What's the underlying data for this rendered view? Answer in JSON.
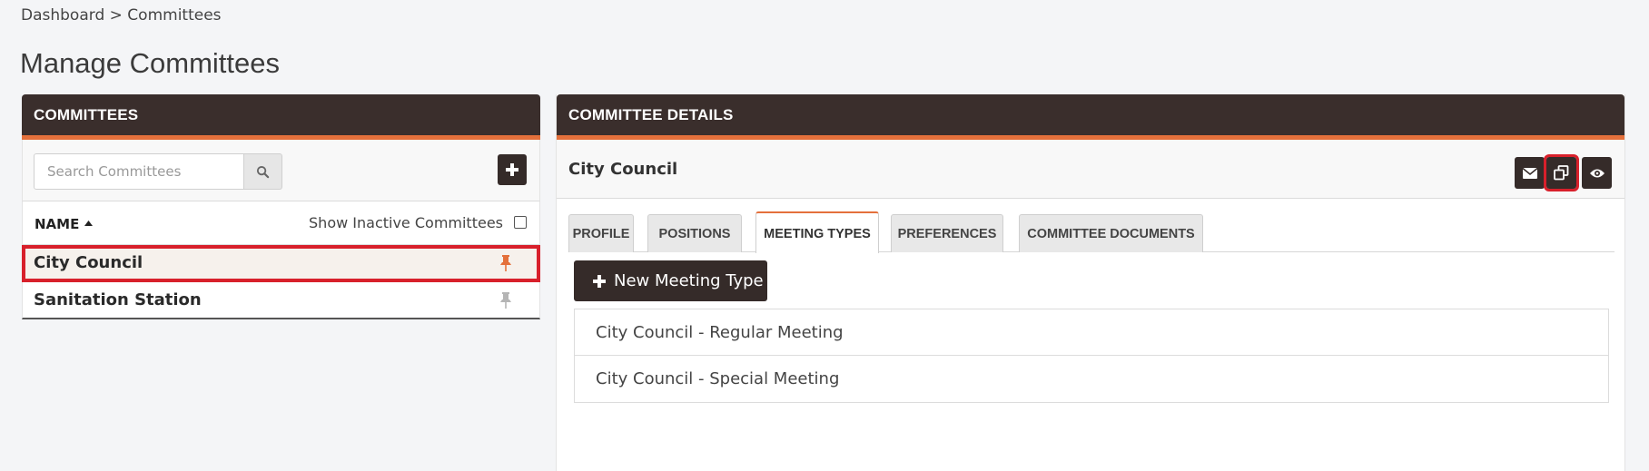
{
  "breadcrumb": {
    "root": "Dashboard",
    "separator": ">",
    "current": "Committees"
  },
  "page_title": "Manage Committees",
  "committees_panel": {
    "title": "COMMITTEES",
    "search_placeholder": "Search Committees",
    "search_icon": "search-icon",
    "add_icon": "plus-icon",
    "column_name": "NAME",
    "sort_icon": "caret-up-icon",
    "show_inactive_label": "Show Inactive Committees",
    "show_inactive_checked": false,
    "items": [
      {
        "label": "City Council",
        "pinned": true,
        "selected": true
      },
      {
        "label": "Sanitation Station",
        "pinned": false,
        "selected": false
      }
    ]
  },
  "details_panel": {
    "title": "COMMITTEE DETAILS",
    "committee_name": "City Council",
    "actions": [
      {
        "icon": "envelope-icon"
      },
      {
        "icon": "copy-icon"
      },
      {
        "icon": "eye-icon"
      }
    ],
    "tabs": [
      {
        "label": "PROFILE",
        "active": false
      },
      {
        "label": "POSITIONS",
        "active": false
      },
      {
        "label": "MEETING TYPES",
        "active": true
      },
      {
        "label": "PREFERENCES",
        "active": false
      },
      {
        "label": "COMMITTEE DOCUMENTS",
        "active": false
      }
    ],
    "new_meeting_type_label": "New Meeting Type",
    "meeting_types": [
      "City Council - Regular Meeting",
      "City Council - Special Meeting"
    ]
  },
  "colors": {
    "header_bg": "#3a2e2c",
    "accent": "#e4703b",
    "highlight": "#d8202b",
    "pin_active": "#e4703b",
    "pin_inactive": "#b5b5b5"
  }
}
